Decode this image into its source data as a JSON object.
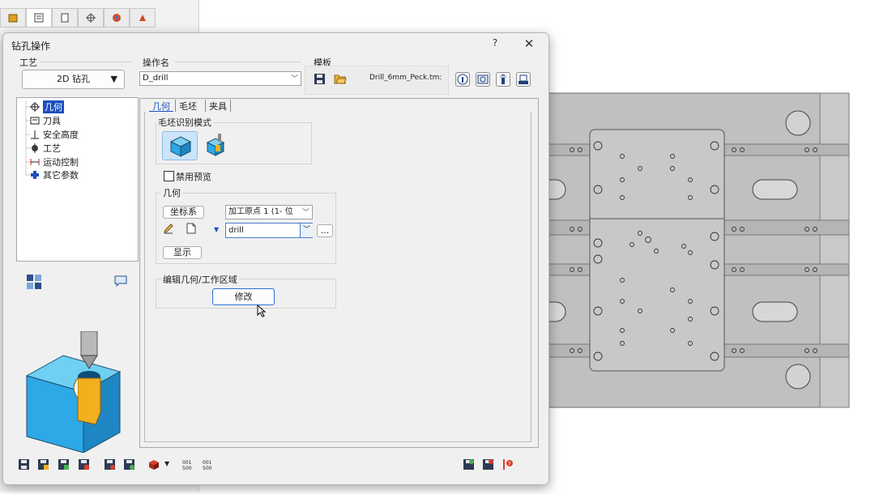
{
  "dialog": {
    "title": "钻孔操作",
    "help_label": "?",
    "close_label": "✕"
  },
  "process": {
    "label": "工艺",
    "value": "2D 钻孔"
  },
  "operation_name": {
    "label": "操作名",
    "value": "D_drill"
  },
  "template": {
    "label": "模板",
    "file_name": "Drill_6mm_Peck.tm:"
  },
  "tree": {
    "items": [
      "几何",
      "刀具",
      "安全高度",
      "工艺",
      "运动控制",
      "其它参数"
    ],
    "selected_index": 0
  },
  "tabs": [
    "几何",
    "毛坯",
    "夹具"
  ],
  "stock_recognition": {
    "label": "毛坯识别模式"
  },
  "disable_preview": {
    "label": "禁用预览",
    "checked": false
  },
  "geometry": {
    "label": "几何",
    "coord_button": "坐标系",
    "origin_select": "加工原点 1 (1- 位",
    "drill_select": "drill",
    "more_button": "...",
    "show_button": "显示"
  },
  "edit_geometry": {
    "label": "编辑几何/工作区域",
    "modify_button": "修改"
  },
  "colors": {
    "accent": "#1d4fbf",
    "preview_block": "#2ea8e6",
    "drill_path": "#f2b01e",
    "cad_plate": "#c3c3c3"
  }
}
